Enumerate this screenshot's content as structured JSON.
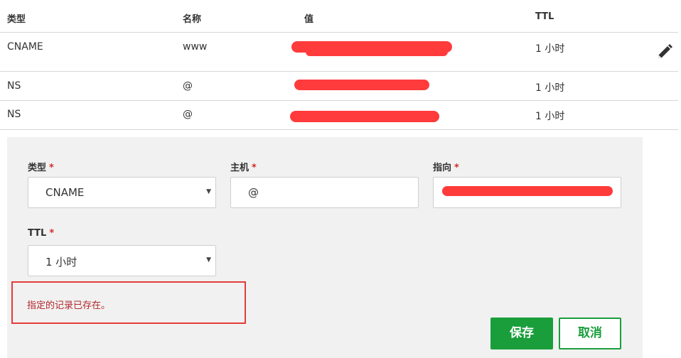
{
  "table": {
    "headers": [
      "类型",
      "名称",
      "值",
      "TTL"
    ],
    "rows": [
      {
        "type": "CNAME",
        "name": "www",
        "value": "",
        "ttl": "1 小时"
      },
      {
        "type": "NS",
        "name": "@",
        "value": "",
        "ttl": "1 小时"
      },
      {
        "type": "NS",
        "name": "@",
        "value": "",
        "ttl": "1 小时"
      }
    ]
  },
  "edit_icon": "pencil-icon",
  "form": {
    "type_label": "类型",
    "type_value": "CNAME",
    "host_label": "主机",
    "host_value": "@",
    "target_label": "指向",
    "target_value": "",
    "ttl_label": "TTL",
    "ttl_value": "1 小时",
    "required_mark": "*",
    "error_message": "指定的记录已存在。",
    "save_label": "保存",
    "cancel_label": "取消"
  },
  "colors": {
    "accent_green": "#1a9e3c",
    "error_red": "#e33b3b",
    "redaction": "#ff3b3b",
    "panel_bg": "#f1f1f1"
  }
}
